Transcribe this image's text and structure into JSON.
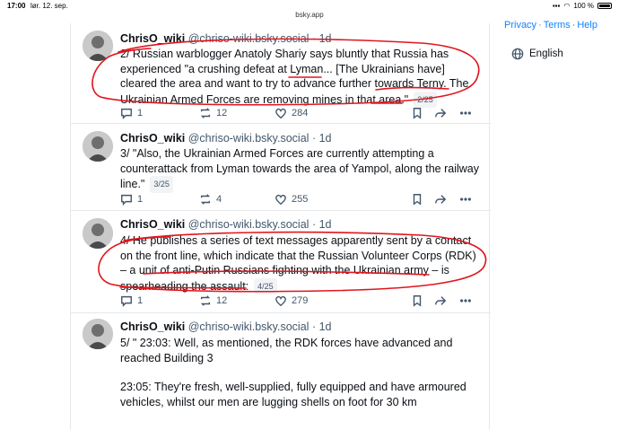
{
  "status_bar": {
    "time": "17:00",
    "date": "lør. 12. sep.",
    "battery": "100 %"
  },
  "browser": {
    "url": "bsky.app"
  },
  "right_panel": {
    "links": [
      "Privacy",
      "Terms",
      "Help"
    ],
    "separator": "·",
    "language": "English"
  },
  "posts": [
    {
      "author": "ChrisO_wiki",
      "handle": "@chriso-wiki.bsky.social",
      "time": "1d",
      "text": "2/ Russian warblogger Anatoly Shariy says bluntly that Russia has experienced \"a crushing defeat at Lyman... [The Ukrainians have] cleared the area and want to try to advance further towards Terny. The Ukrainian Armed Forces are removing mines in that area.\"",
      "counter": "2/25",
      "replies": "1",
      "reposts": "12",
      "likes": "284"
    },
    {
      "author": "ChrisO_wiki",
      "handle": "@chriso-wiki.bsky.social",
      "time": "1d",
      "text": "3/ \"Also, the Ukrainian Armed Forces are currently attempting a counterattack from Lyman towards the area of Yampol, along the railway line.\"",
      "counter": "3/25",
      "replies": "1",
      "reposts": "4",
      "likes": "255"
    },
    {
      "author": "ChrisO_wiki",
      "handle": "@chriso-wiki.bsky.social",
      "time": "1d",
      "text": "4/ He publishes a series of text messages apparently sent by a contact on the front line, which indicate that the Russian Volunteer Corps (RDK) – a unit of anti-Putin Russians fighting with the Ukrainian army – is spearheading the assault:",
      "counter": "4/25",
      "replies": "1",
      "reposts": "12",
      "likes": "279"
    },
    {
      "author": "ChrisO_wiki",
      "handle": "@chriso-wiki.bsky.social",
      "time": "1d",
      "text_lines": [
        "5/ \" 23:03: Well, as mentioned, the RDK forces have advanced and reached Building 3",
        "23:05: They're fresh, well-supplied, fully equipped and have armoured vehicles, whilst our men are lugging shells on foot for 30 km"
      ]
    }
  ],
  "colors": {
    "text": "#0b0f14",
    "muted": "#42576c",
    "link": "#1083fe",
    "annotation": "#e0161e"
  },
  "icons": [
    "reply-icon",
    "repost-icon",
    "like-icon",
    "bookmark-icon",
    "share-icon",
    "more-icon",
    "globe-icon",
    "wifi-icon",
    "battery-icon"
  ]
}
